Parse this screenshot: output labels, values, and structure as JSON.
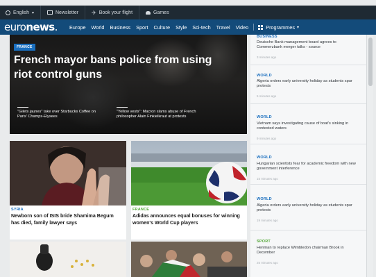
{
  "utilbar": {
    "language": "English",
    "newsletter": "Newsletter",
    "flight": "Book your flight",
    "games": "Games"
  },
  "brand": {
    "logo_light": "euro",
    "logo_bold": "news",
    "logo_dot": "."
  },
  "nav": {
    "links": [
      "Europe",
      "World",
      "Business",
      "Sport",
      "Culture",
      "Style",
      "Sci-tech",
      "Travel",
      "Video"
    ],
    "programmes": "Programmes"
  },
  "hero": {
    "tag": "FRANCE",
    "title": "French mayor bans police from using riot control guns",
    "sub_left": "\"Gilets jaunes\" take over Starbucks Coffee on Paris' Champs-Elysees",
    "sub_right": "\"Yellow vests\": Macron slams abuse of French philosopher Alain Finkielkraut at protests"
  },
  "cards": [
    {
      "label": "SYRIA",
      "title": "Newborn son of ISIS bride Shamima Begum has died, family lawyer says",
      "label_color": "#1a6fbf"
    },
    {
      "label": "FRANCE",
      "title": "Adidas announces equal bonuses for winning women's World Cup players",
      "label_color": "#56a83a"
    }
  ],
  "sidebar": {
    "items": [
      {
        "category": "BUSINESS",
        "text": "Deutsche Bank management board agrees to Commerzbank merger talks - source",
        "time": "3 minutes ago",
        "color": "#1a6fbf"
      },
      {
        "category": "WORLD",
        "text": "Algeria orders early university holiday as students spur protests",
        "time": "5 minutes ago",
        "color": "#1a6fbf"
      },
      {
        "category": "WORLD",
        "text": "Vietnam says investigating cause of boat's sinking in contested waters",
        "time": "9 minutes ago",
        "color": "#1a6fbf"
      },
      {
        "category": "WORLD",
        "text": "Hungarian scientists fear for academic freedom with new government interference",
        "time": "15 minutes ago",
        "color": "#1a6fbf"
      },
      {
        "category": "WORLD",
        "text": "Algeria orders early university holiday as students spur protests",
        "time": "19 minutes ago",
        "color": "#1a6fbf"
      },
      {
        "category": "SPORT",
        "text": "Henman to replace Wimbledon chairman Brook in December",
        "time": "25 minutes ago",
        "color": "#56a83a"
      }
    ]
  }
}
